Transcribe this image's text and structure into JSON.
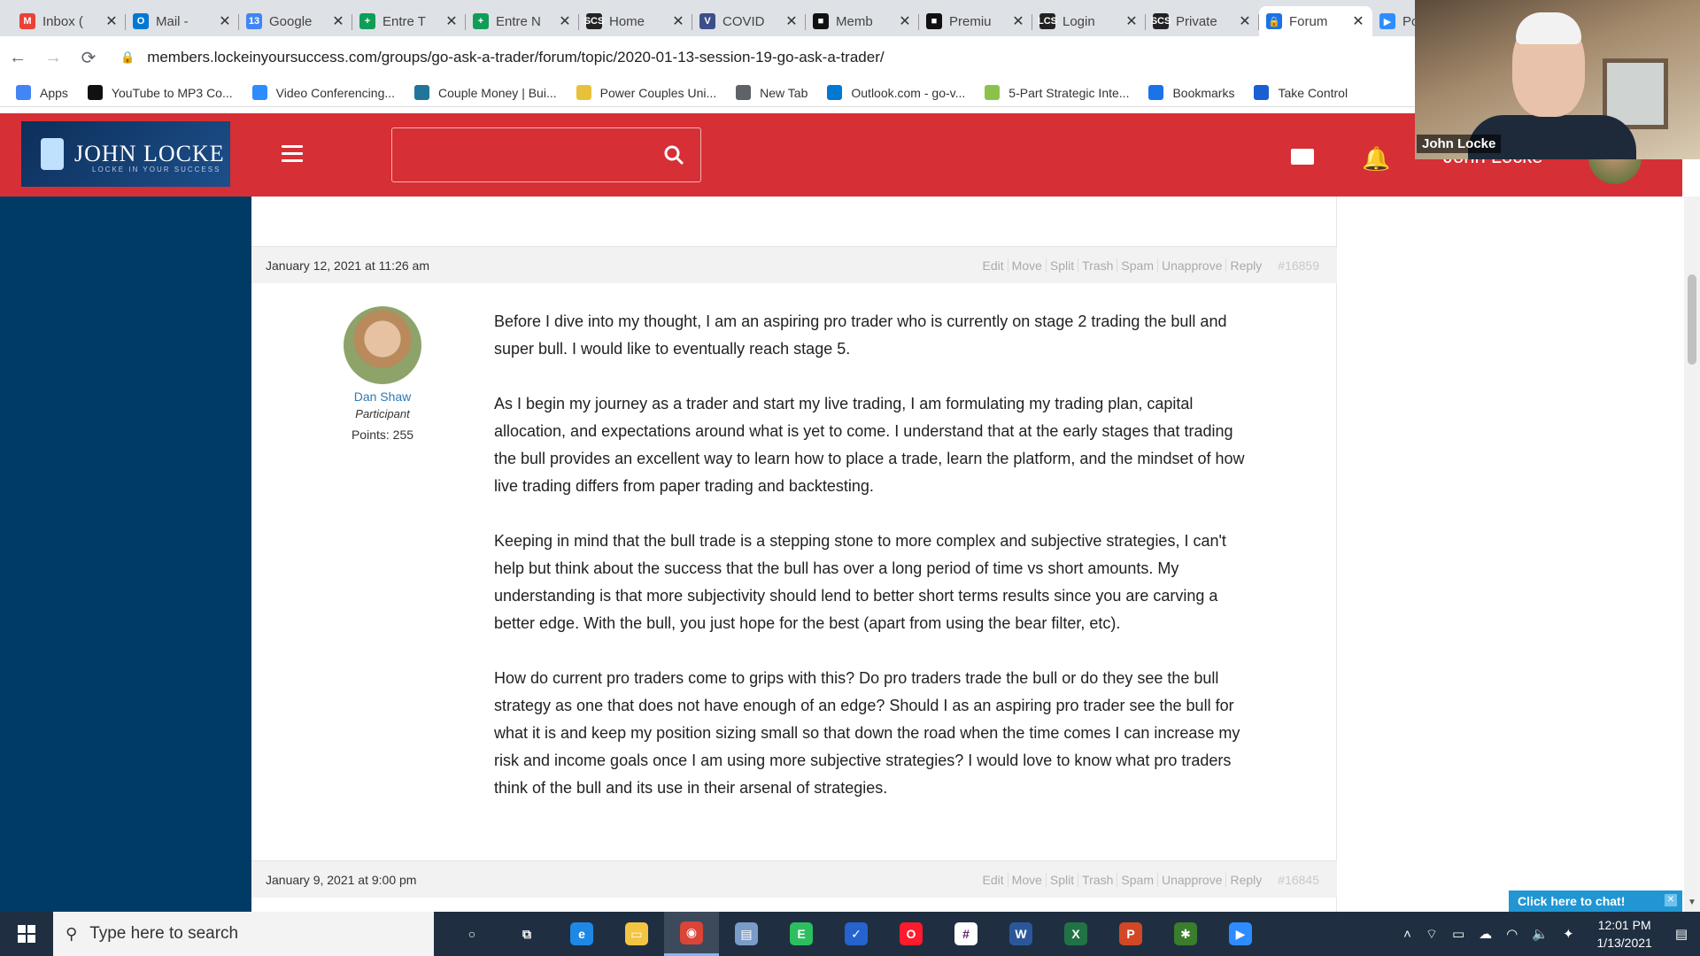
{
  "tabs": [
    {
      "title": "Inbox (",
      "color": "#ea4335",
      "glyph": "M"
    },
    {
      "title": "Mail -",
      "color": "#0078d4",
      "glyph": "O"
    },
    {
      "title": "Google",
      "color": "#4285f4",
      "glyph": "13"
    },
    {
      "title": "Entre T",
      "color": "#0f9d58",
      "glyph": "+"
    },
    {
      "title": "Entre N",
      "color": "#0f9d58",
      "glyph": "+"
    },
    {
      "title": "Home",
      "color": "#222222",
      "glyph": "SCS"
    },
    {
      "title": "COVID",
      "color": "#3b4f8a",
      "glyph": "V"
    },
    {
      "title": "Memb",
      "color": "#111111",
      "glyph": "■"
    },
    {
      "title": "Premiu",
      "color": "#111111",
      "glyph": "■"
    },
    {
      "title": "Login",
      "color": "#222222",
      "glyph": "LCS"
    },
    {
      "title": "Private",
      "color": "#222222",
      "glyph": "SCS"
    },
    {
      "title": "Forum",
      "color": "#1a73e8",
      "glyph": "🔒",
      "active": true
    },
    {
      "title": "Post A",
      "color": "#2d8cff",
      "glyph": "▶"
    }
  ],
  "browser": {
    "url": "members.lockeinyoursuccess.com/groups/go-ask-a-trader/forum/topic/2020-01-13-session-19-go-ask-a-trader/"
  },
  "bookmarks": [
    {
      "label": "Apps",
      "color": "#4285f4"
    },
    {
      "label": "YouTube to MP3 Co...",
      "color": "#111111"
    },
    {
      "label": "Video Conferencing...",
      "color": "#2d8cff"
    },
    {
      "label": "Couple Money | Bui...",
      "color": "#21759b"
    },
    {
      "label": "Power Couples Uni...",
      "color": "#e8c13b"
    },
    {
      "label": "New Tab",
      "color": "#5f6368"
    },
    {
      "label": "Outlook.com - go-v...",
      "color": "#0078d4"
    },
    {
      "label": "5-Part Strategic Inte...",
      "color": "#8bc34a"
    },
    {
      "label": "Bookmarks",
      "color": "#1a73e8"
    },
    {
      "label": "Take Control",
      "color": "#1a5fd1"
    }
  ],
  "site": {
    "logo_name": "JOHN LOCKE",
    "logo_tag": "LOCKE IN YOUR SUCCESS",
    "user_name": "John Locke"
  },
  "reply1": {
    "date": "January 12, 2021 at 11:26 am",
    "actions": [
      "Edit",
      "Move",
      "Split",
      "Trash",
      "Spam",
      "Unapprove",
      "Reply"
    ],
    "post_id": "#16859",
    "author": {
      "name": "Dan Shaw",
      "role": "Participant",
      "points": "Points: 255"
    },
    "paragraphs": [
      "Before I dive into my thought, I am an aspiring pro trader who is currently on stage 2 trading the bull and super bull. I would like to eventually reach stage 5.",
      "As I begin my journey as a trader and start my live trading, I am formulating my trading plan, capital allocation, and expectations around what is yet to come. I understand that at the early stages that trading the bull provides an excellent way to learn how to place a trade, learn the platform, and the mindset of how live trading differs from paper trading and backtesting.",
      "Keeping in mind that the bull trade is a stepping stone to more complex and subjective strategies, I can't help but think about the success that the bull has over a long period of time vs short amounts. My understanding is that more subjectivity should lend to better short terms results since you are carving a better edge. With the bull, you just hope for the best (apart from using the bear filter, etc).",
      "How do current pro traders come to grips with this? Do pro traders trade the bull or do they see the bull strategy as one that does not have enough of an edge? Should I as an aspiring pro trader see the bull for what it is and keep my position sizing small so that down the road when the time comes I can increase my risk and income goals once I am using more subjective strategies? I would love to know what pro traders think of the bull and its use in their arsenal of strategies."
    ]
  },
  "reply2": {
    "date": "January 9, 2021 at 9:00 pm",
    "actions": [
      "Edit",
      "Move",
      "Split",
      "Trash",
      "Spam",
      "Unapprove",
      "Reply"
    ],
    "post_id": "#16845"
  },
  "webcam": {
    "label": "John Locke"
  },
  "chat": {
    "label": "Click here to chat!"
  },
  "taskbar": {
    "search_placeholder": "Type here to search",
    "apps": [
      {
        "name": "cortana",
        "color": "#1f2f41",
        "glyph": "○"
      },
      {
        "name": "task-view",
        "color": "#1f2f41",
        "glyph": "⧉"
      },
      {
        "name": "edge",
        "color": "#1e88e5",
        "glyph": "e"
      },
      {
        "name": "file-explorer",
        "color": "#f4c542",
        "glyph": "▭"
      },
      {
        "name": "chrome",
        "color": "#db4437",
        "glyph": "◉",
        "active": true
      },
      {
        "name": "notebook",
        "color": "#7a9cc6",
        "glyph": "▤"
      },
      {
        "name": "evernote",
        "color": "#2dbe60",
        "glyph": "E"
      },
      {
        "name": "todo",
        "color": "#2564cf",
        "glyph": "✓"
      },
      {
        "name": "opera",
        "color": "#ff1b2d",
        "glyph": "O"
      },
      {
        "name": "slack",
        "color": "#ffffff",
        "glyph": "#"
      },
      {
        "name": "word",
        "color": "#2b579a",
        "glyph": "W"
      },
      {
        "name": "excel",
        "color": "#217346",
        "glyph": "X"
      },
      {
        "name": "powerpoint",
        "color": "#d24726",
        "glyph": "P"
      },
      {
        "name": "xmind",
        "color": "#3a7d2c",
        "glyph": "✱"
      },
      {
        "name": "zoom",
        "color": "#2d8cff",
        "glyph": "▶"
      }
    ],
    "time": "12:01 PM",
    "date": "1/13/2021"
  }
}
